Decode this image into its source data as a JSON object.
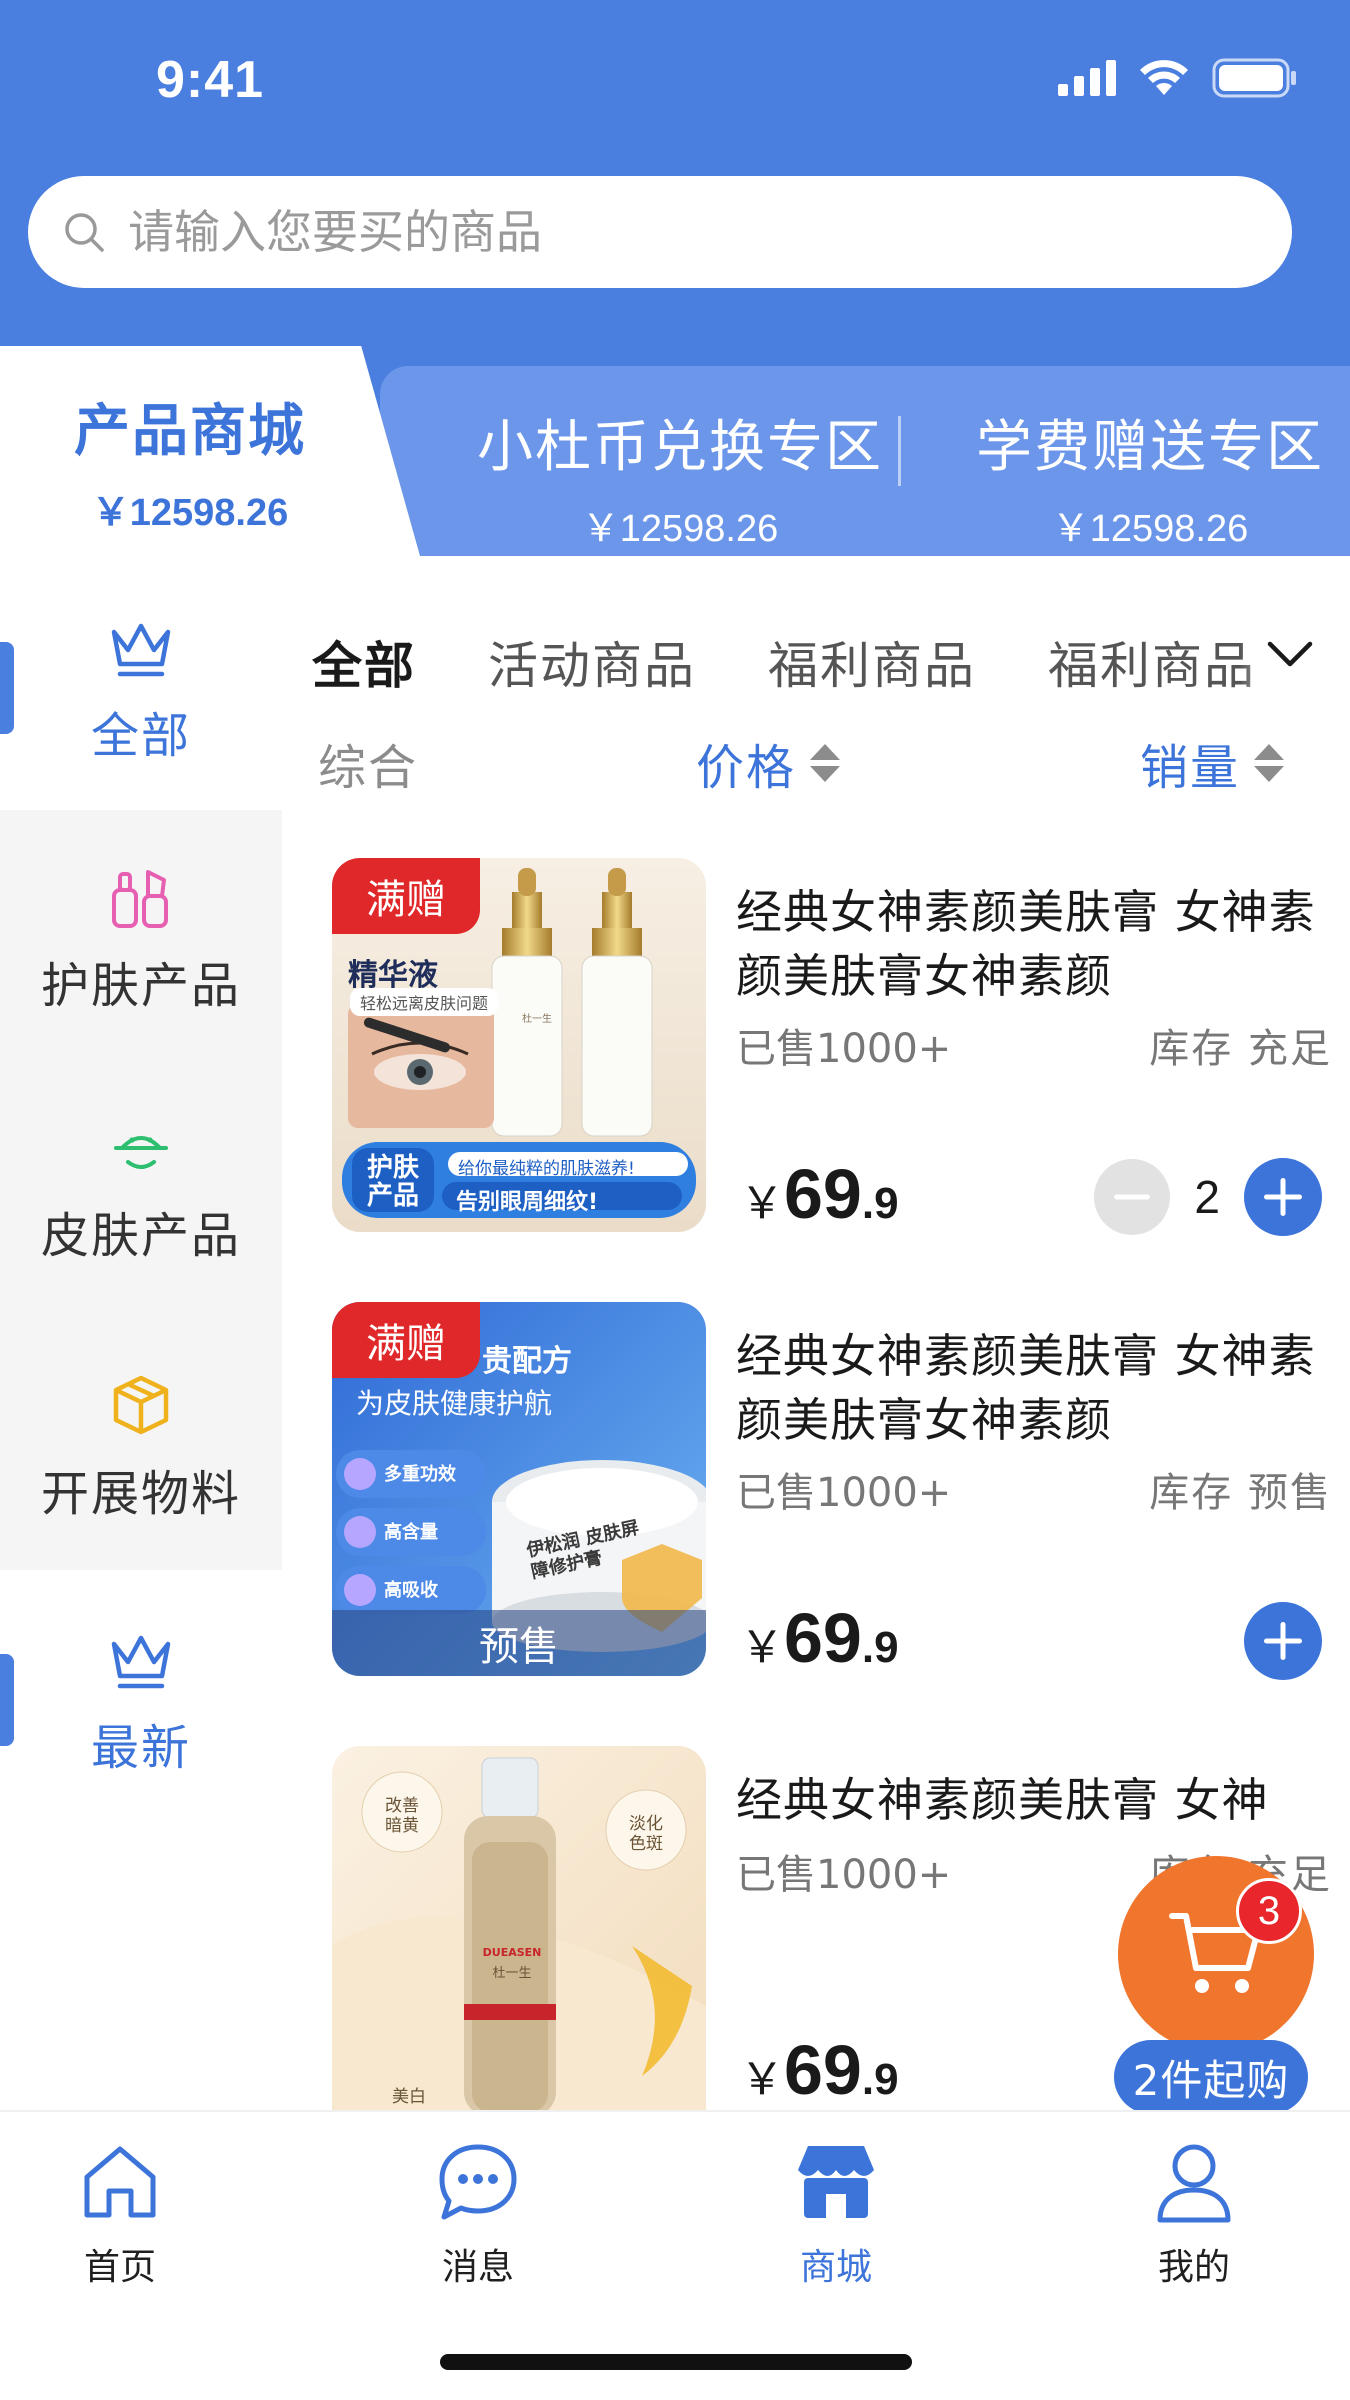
{
  "status_bar": {
    "time": "9:41"
  },
  "search": {
    "placeholder": "请输入您要买的商品"
  },
  "mall_tabs": [
    {
      "title": "产品商城",
      "amount": "￥12598.26",
      "active": true
    },
    {
      "title": "小杜币兑换专区",
      "amount": "￥12598.26",
      "active": false
    },
    {
      "title": "学费赠送专区",
      "amount": "￥12598.26",
      "active": false
    }
  ],
  "sidebar": {
    "items": [
      {
        "label": "全部",
        "icon": "crown-icon",
        "active": true
      },
      {
        "label": "护肤产品",
        "icon": "cosmetics-icon",
        "active": false
      },
      {
        "label": "皮肤产品",
        "icon": "smile-face-icon",
        "active": false
      },
      {
        "label": "开展物料",
        "icon": "box-icon",
        "active": false
      },
      {
        "label": "最新",
        "icon": "crown-icon",
        "active": true
      }
    ]
  },
  "category_tabs": [
    "全部",
    "活动商品",
    "福利商品",
    "福利商品"
  ],
  "sort": {
    "general": "综合",
    "price": "价格",
    "sales": "销量"
  },
  "products": [
    {
      "badge": "满赠",
      "name": "经典女神素颜美肤膏 女神素颜美肤膏女神素颜",
      "sold": "已售1000+",
      "stock_label": "库存",
      "stock_status": "充足",
      "price_currency": "￥",
      "price_int": "69",
      "price_dec": ".9",
      "quantity": "2",
      "image_texts": {
        "brand": "杜一生",
        "title": "精华液",
        "tagline": "轻松远离皮肤问题",
        "promo_small": "给你最纯粹的肌肤滋养!",
        "promo_big": "告别眼周细纹!",
        "promo_tag": "护肤产品"
      }
    },
    {
      "badge": "满赠",
      "name": "经典女神素颜美肤膏 女神素颜美肤膏女神素颜",
      "sold": "已售1000+",
      "stock_label": "库存",
      "stock_status": "预售",
      "price_currency": "￥",
      "price_int": "69",
      "price_dec": ".9",
      "presale_band": "预售",
      "image_texts": {
        "title": "贵配方",
        "subtitle": "为皮肤健康护航",
        "feat1": "多重功效",
        "feat2": "高含量",
        "feat3": "高吸收",
        "jar": "伊松润 皮肤屏障修护膏"
      }
    },
    {
      "name": "经典女神素颜美肤膏 女神",
      "sold": "已售1000+",
      "stock_label": "库存",
      "stock_status": "充足",
      "price_currency": "￥",
      "price_int": "69",
      "price_dec": ".9",
      "image_texts": {
        "tag1": "改善暗黄",
        "tag2": "淡化色斑",
        "tag3": "美白",
        "brand": "DUEASEN",
        "brand_cn": "杜一生"
      }
    }
  ],
  "cart": {
    "count": "3",
    "min_label": "2件起购"
  },
  "bottom_nav": [
    {
      "label": "首页",
      "icon": "home-icon",
      "active": false
    },
    {
      "label": "消息",
      "icon": "message-icon",
      "active": false
    },
    {
      "label": "商城",
      "icon": "shop-icon",
      "active": true
    },
    {
      "label": "我的",
      "icon": "user-icon",
      "active": false
    }
  ],
  "colors": {
    "primary": "#4a7fe0",
    "accent_blue": "#3d74da",
    "badge_red": "#e0282a",
    "cart_orange": "#f0762e"
  }
}
